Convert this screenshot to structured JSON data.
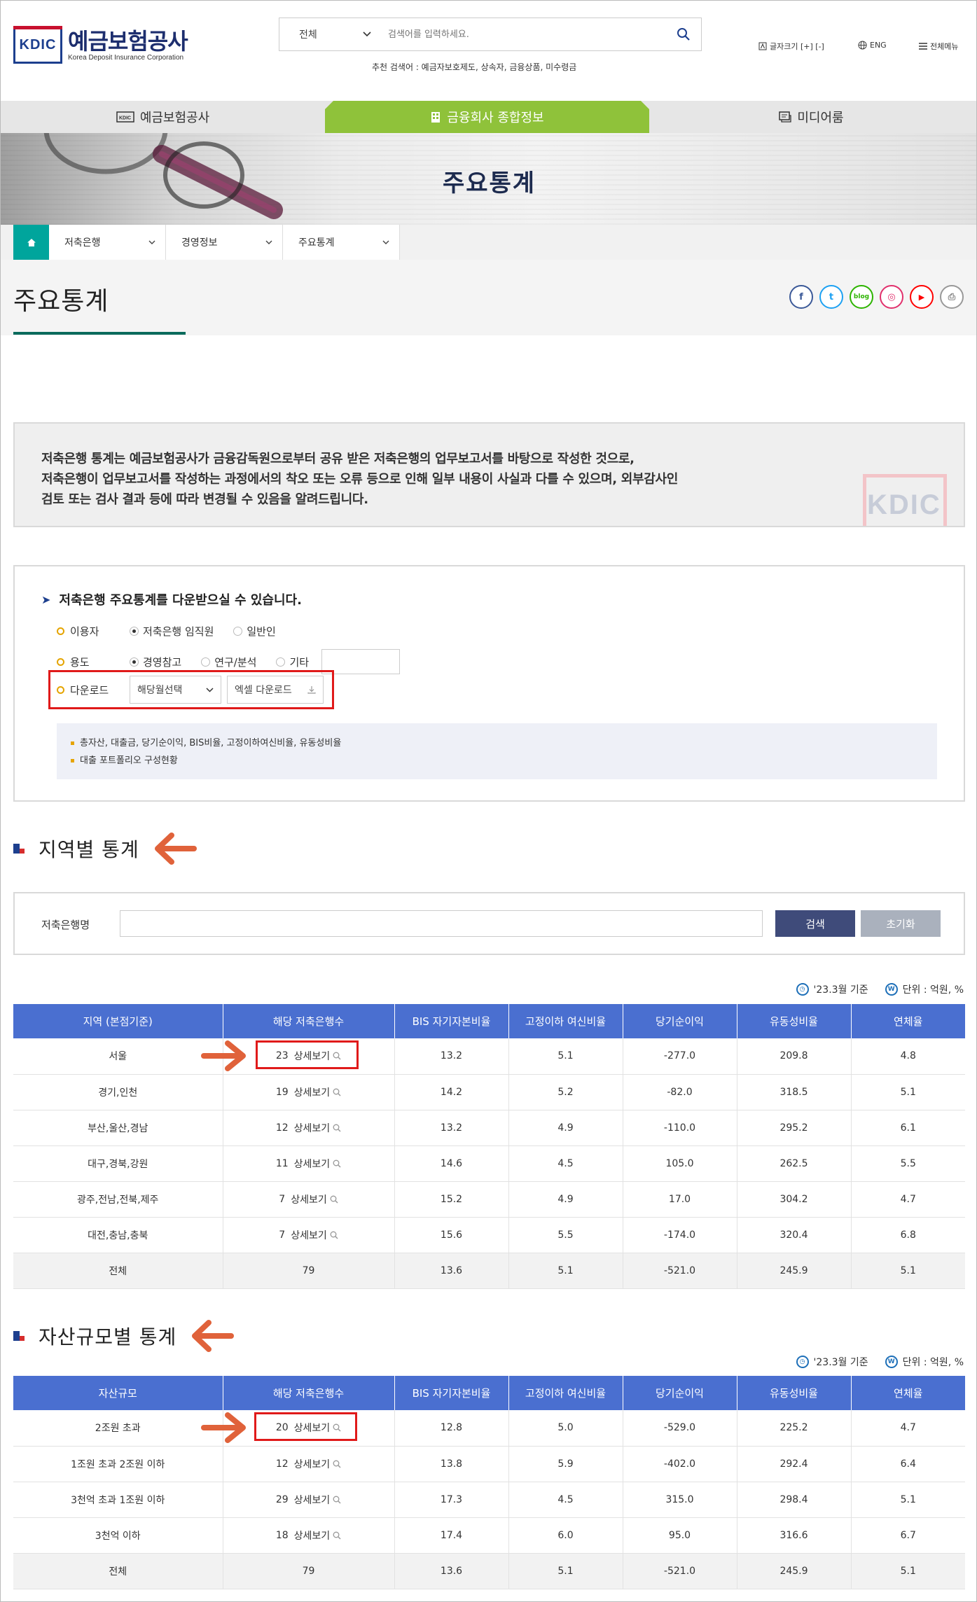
{
  "header": {
    "logo_mark": "KDIC",
    "logo_name": "예금보험공사",
    "logo_en": "Korea Deposit Insurance Corporation",
    "search_scope": "전체",
    "search_placeholder": "검색어를 입력하세요.",
    "recommend": "추천 검색어 : 예금자보호제도, 상속자, 금융상품, 미수령금",
    "font_size_label": "글자크기 [+] [-]",
    "lang_label": "ENG",
    "menu_label": "전체메뉴"
  },
  "gnb": [
    {
      "label": "예금보험공사",
      "icon": "kdic-icon"
    },
    {
      "label": "금융회사 종합정보",
      "icon": "building-icon",
      "active": true
    },
    {
      "label": "미디어룸",
      "icon": "media-icon"
    }
  ],
  "banner": {
    "title": "주요통계"
  },
  "breadcrumb": [
    {
      "label": "저축은행"
    },
    {
      "label": "경영정보"
    },
    {
      "label": "주요통계"
    }
  ],
  "page": {
    "title": "주요통계"
  },
  "sns": [
    {
      "name": "facebook-icon",
      "glyph": "f",
      "color": "#3b5998"
    },
    {
      "name": "twitter-icon",
      "glyph": "t",
      "color": "#1da1f2"
    },
    {
      "name": "blog-icon",
      "glyph": "blog",
      "color": "#2db400"
    },
    {
      "name": "instagram-icon",
      "glyph": "◎",
      "color": "#e1306c"
    },
    {
      "name": "youtube-icon",
      "glyph": "▶",
      "color": "#ff0000"
    },
    {
      "name": "print-icon",
      "glyph": "⎙",
      "color": "#888888"
    }
  ],
  "notice": {
    "line1": "저축은행 통계는 예금보험공사가 금융감독원으로부터 공유 받은 저축은행의 업무보고서를 바탕으로 작성한 것으로,",
    "line2": "저축은행이 업무보고서를 작성하는 과정에서의 착오 또는 오류 등으로 인해 일부 내용이 사실과 다를 수 있으며, 외부감사인",
    "line3": "검토 또는 검사 결과 등에 따라 변경될 수 있음을 알려드립니다.",
    "watermark": "KDIC"
  },
  "download": {
    "heading": "저축은행 주요통계를 다운받으실 수 있습니다.",
    "user_label": "이용자",
    "user_options": [
      "저축은행 임직원",
      "일반인"
    ],
    "purpose_label": "용도",
    "purpose_options": [
      "경영참고",
      "연구/분석",
      "기타"
    ],
    "download_label": "다운로드",
    "select_value": "해당월선택",
    "excel_button": "엑셀 다운로드",
    "info": [
      "총자산, 대출금, 당기순이익, BIS비율, 고정이하여신비율, 유동성비율",
      "대출 포트폴리오 구성현황"
    ]
  },
  "region_section": {
    "title": "지역별 통계",
    "filter_label": "저축은행명",
    "search_button": "검색",
    "reset_button": "초기화",
    "basis": "'23.3월 기준",
    "unit": "단위 : 억원, %",
    "columns": [
      "지역 (본점기준)",
      "해당 저축은행수",
      "BIS 자기자본비율",
      "고정이하 여신비율",
      "당기순이익",
      "유동성비율",
      "연체율"
    ],
    "detail_label": "상세보기",
    "rows": [
      {
        "name": "서울",
        "count": "23",
        "bis": "13.2",
        "npl": "5.1",
        "income": "-277.0",
        "liq": "209.8",
        "delin": "4.8"
      },
      {
        "name": "경기,인천",
        "count": "19",
        "bis": "14.2",
        "npl": "5.2",
        "income": "-82.0",
        "liq": "318.5",
        "delin": "5.1"
      },
      {
        "name": "부산,울산,경남",
        "count": "12",
        "bis": "13.2",
        "npl": "4.9",
        "income": "-110.0",
        "liq": "295.2",
        "delin": "6.1"
      },
      {
        "name": "대구,경북,강원",
        "count": "11",
        "bis": "14.6",
        "npl": "4.5",
        "income": "105.0",
        "liq": "262.5",
        "delin": "5.5"
      },
      {
        "name": "광주,전남,전북,제주",
        "count": "7",
        "bis": "15.2",
        "npl": "4.9",
        "income": "17.0",
        "liq": "304.2",
        "delin": "4.7"
      },
      {
        "name": "대전,충남,충북",
        "count": "7",
        "bis": "15.6",
        "npl": "5.5",
        "income": "-174.0",
        "liq": "320.4",
        "delin": "6.8"
      }
    ],
    "total": {
      "name": "전체",
      "count": "79",
      "bis": "13.6",
      "npl": "5.1",
      "income": "-521.0",
      "liq": "245.9",
      "delin": "5.1"
    }
  },
  "asset_section": {
    "title": "자산규모별 통계",
    "basis": "'23.3월 기준",
    "unit": "단위 : 억원, %",
    "columns": [
      "자산규모",
      "해당 저축은행수",
      "BIS 자기자본비율",
      "고정이하 여신비율",
      "당기순이익",
      "유동성비율",
      "연체율"
    ],
    "detail_label": "상세보기",
    "rows": [
      {
        "name": "2조원 초과",
        "count": "20",
        "bis": "12.8",
        "npl": "5.0",
        "income": "-529.0",
        "liq": "225.2",
        "delin": "4.7"
      },
      {
        "name": "1조원 초과 2조원 이하",
        "count": "12",
        "bis": "13.8",
        "npl": "5.9",
        "income": "-402.0",
        "liq": "292.4",
        "delin": "6.4"
      },
      {
        "name": "3천억 초과 1조원 이하",
        "count": "29",
        "bis": "17.3",
        "npl": "4.5",
        "income": "315.0",
        "liq": "298.4",
        "delin": "5.1"
      },
      {
        "name": "3천억 이하",
        "count": "18",
        "bis": "17.4",
        "npl": "6.0",
        "income": "95.0",
        "liq": "316.6",
        "delin": "6.7"
      }
    ],
    "total": {
      "name": "전체",
      "count": "79",
      "bis": "13.6",
      "npl": "5.1",
      "income": "-521.0",
      "liq": "245.9",
      "delin": "5.1"
    }
  },
  "colors": {
    "brand_navy": "#1d3f8e",
    "gnb_active": "#8fc23a",
    "home_teal": "#00a59c",
    "table_header": "#4a6fd0",
    "highlight_red": "#e01a1a",
    "arrow_orange": "#e0623a"
  }
}
